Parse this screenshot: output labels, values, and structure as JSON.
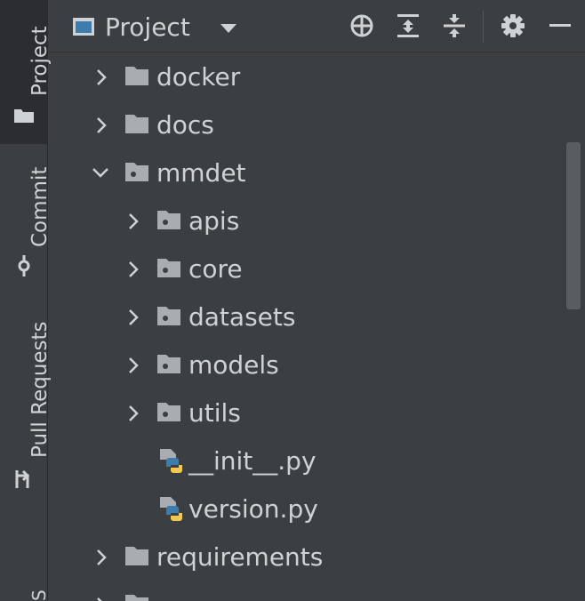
{
  "sidebar": {
    "tabs": [
      {
        "label": "Project"
      },
      {
        "label": "Commit"
      },
      {
        "label": "Pull Requests"
      },
      {
        "label": "S"
      }
    ]
  },
  "header": {
    "title": "Project"
  },
  "tree": {
    "items": [
      {
        "label": "docker",
        "type": "folder",
        "expanded": false,
        "depth": 0
      },
      {
        "label": "docs",
        "type": "folder",
        "expanded": false,
        "depth": 0
      },
      {
        "label": "mmdet",
        "type": "package",
        "expanded": true,
        "depth": 0
      },
      {
        "label": "apis",
        "type": "package",
        "expanded": false,
        "depth": 1
      },
      {
        "label": "core",
        "type": "package",
        "expanded": false,
        "depth": 1
      },
      {
        "label": "datasets",
        "type": "package",
        "expanded": false,
        "depth": 1
      },
      {
        "label": "models",
        "type": "package",
        "expanded": false,
        "depth": 1
      },
      {
        "label": "utils",
        "type": "package",
        "expanded": false,
        "depth": 1
      },
      {
        "label": "__init__.py",
        "type": "python-file",
        "depth": 1
      },
      {
        "label": "version.py",
        "type": "python-file",
        "depth": 1
      },
      {
        "label": "requirements",
        "type": "folder",
        "expanded": false,
        "depth": 0
      },
      {
        "label": "",
        "type": "folder",
        "expanded": false,
        "depth": 0
      }
    ]
  },
  "colors": {
    "background": "#3c3f41",
    "text": "#cfd2d4",
    "folder": "#a9acb0",
    "python_blue": "#3f7cac",
    "python_yellow": "#f2c94c"
  }
}
